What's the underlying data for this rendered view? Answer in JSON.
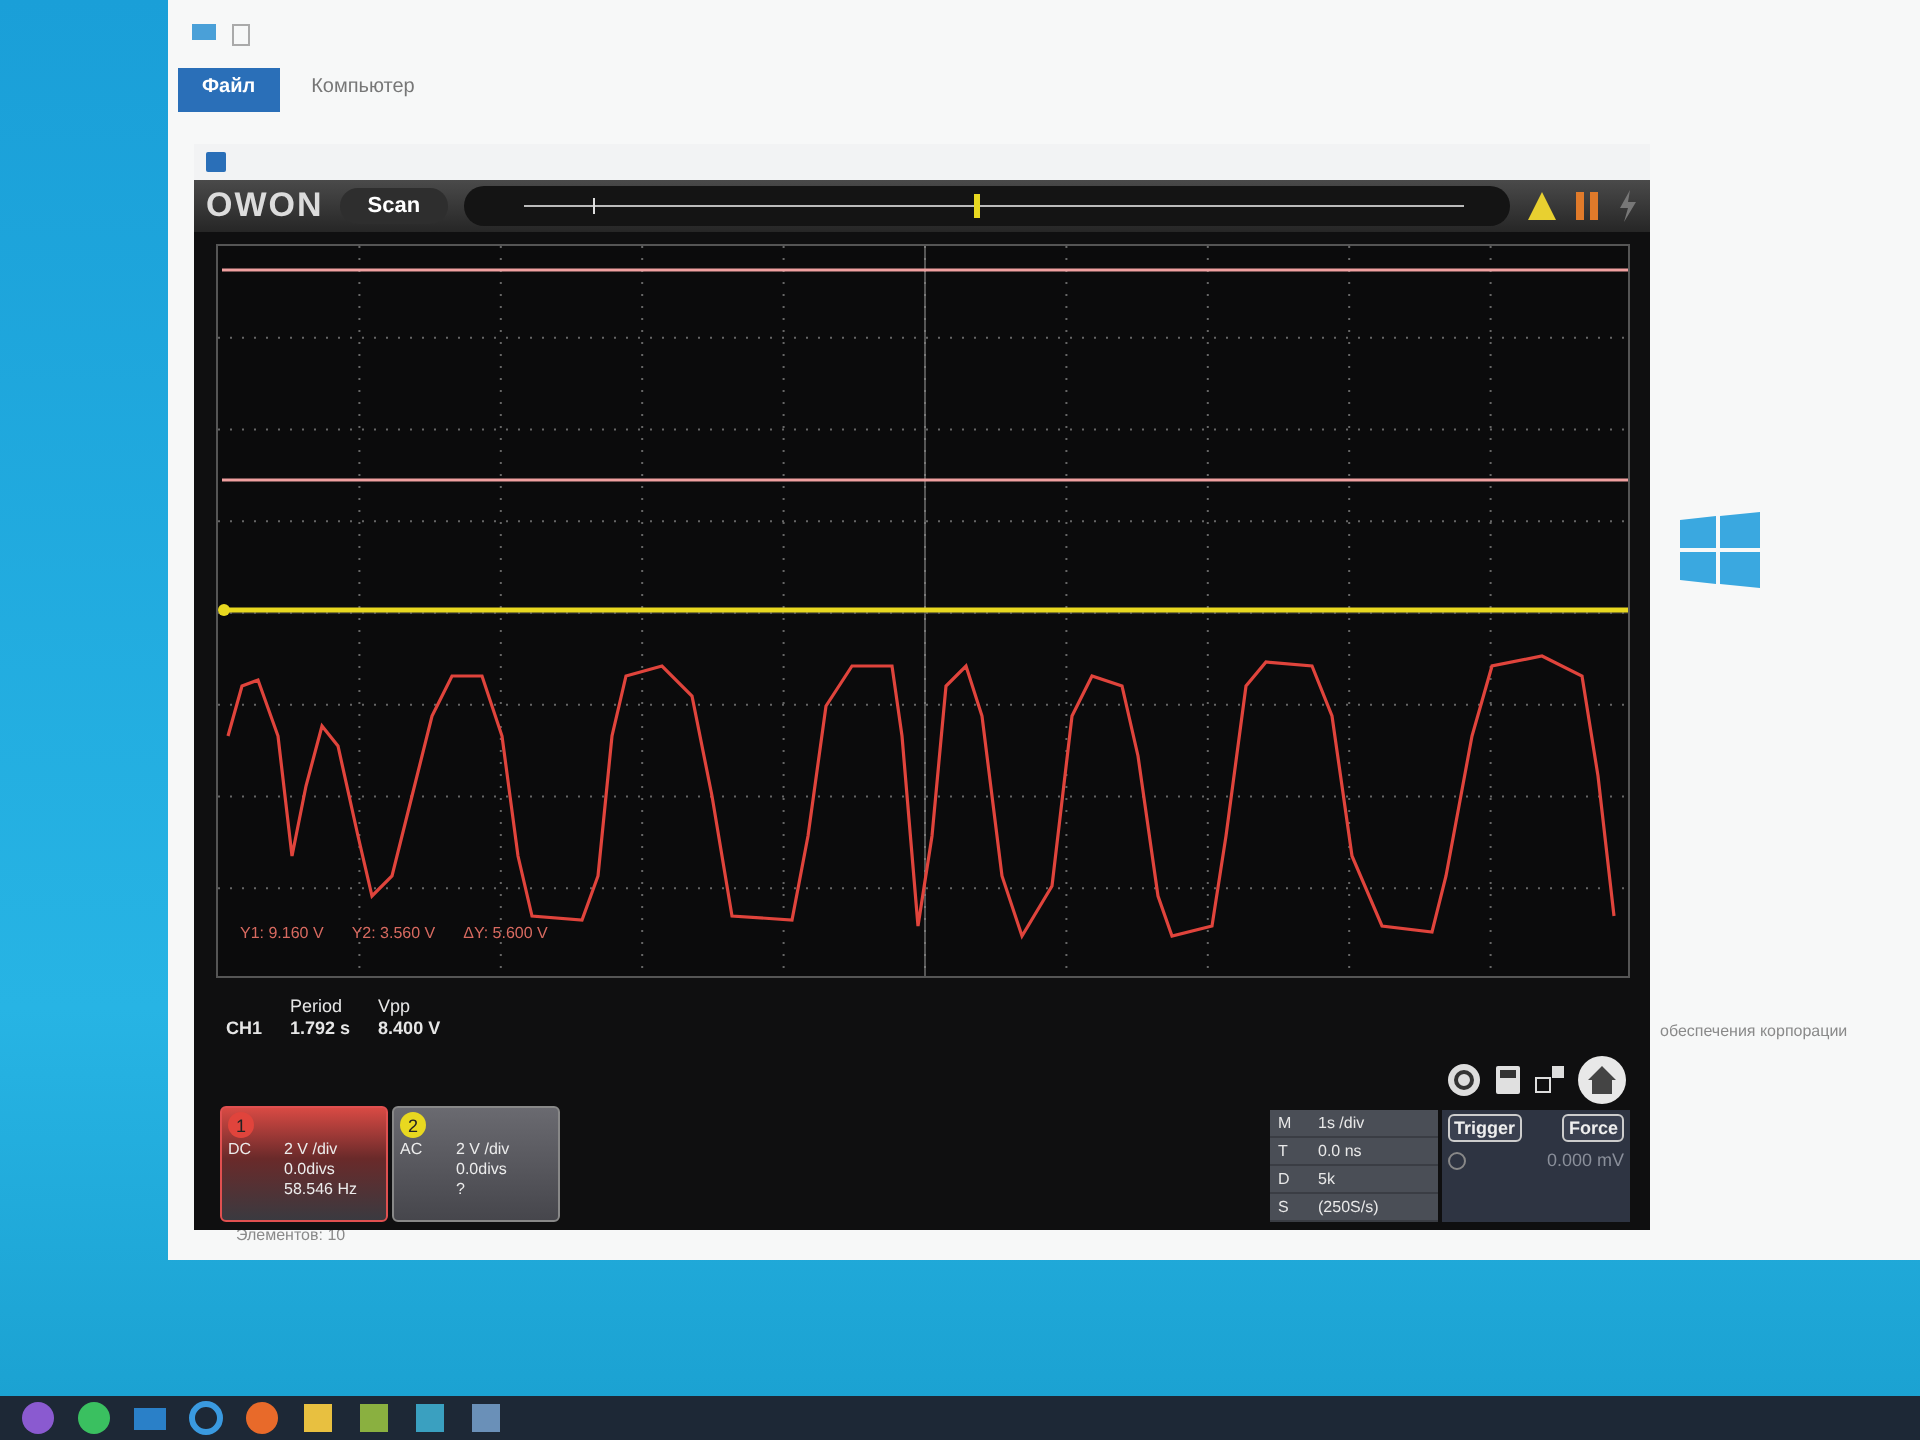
{
  "explorer": {
    "tabs": [
      {
        "label": "Файл",
        "selected": true
      },
      {
        "label": "Компьютер",
        "selected": false
      }
    ],
    "status": "Элементов: 10",
    "side_note": "обеспечения корпорации"
  },
  "scope": {
    "logo": "OWON",
    "scan_button": "Scan",
    "position_slider": {
      "level": 0.48
    },
    "cursor_readouts": [
      "Y1: 9.160 V",
      "Y2: 3.560 V",
      "ΔY: 5.600 V"
    ],
    "measurements": {
      "channel": "CH1",
      "items": [
        {
          "label": "Period",
          "value": "1.792 s"
        },
        {
          "label": "Vpp",
          "value": "8.400 V"
        }
      ]
    },
    "channels": [
      {
        "number": "1",
        "color": "#e0443c",
        "selected": true,
        "coupling": "DC",
        "scale": "2 V /div",
        "offset": "0.0divs",
        "reading": "58.546 Hz"
      },
      {
        "number": "2",
        "color": "#e8d820",
        "selected": false,
        "coupling": "AC",
        "scale": "2 V /div",
        "offset": "0.0divs",
        "reading": "?"
      }
    ],
    "timebase": [
      {
        "key": "M",
        "value": "1s /div"
      },
      {
        "key": "T",
        "value": "0.0 ns"
      },
      {
        "key": "D",
        "value": "5k"
      },
      {
        "key": "S",
        "value": "(250S/s)"
      }
    ],
    "trigger": {
      "buttons": [
        "Trigger",
        "Force"
      ],
      "level": "0.000 mV"
    }
  }
}
